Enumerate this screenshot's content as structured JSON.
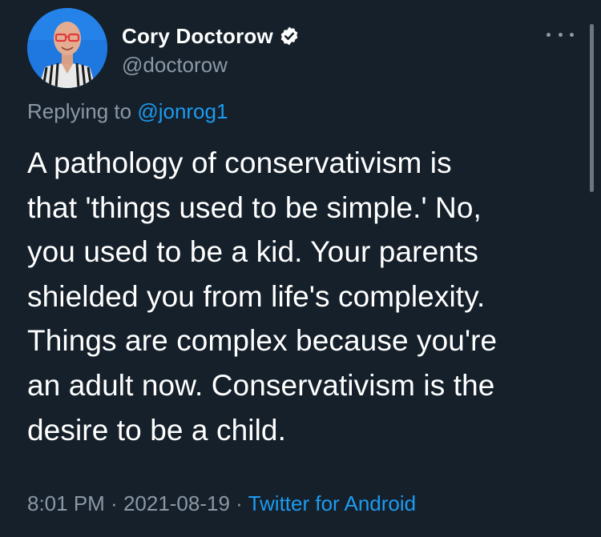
{
  "tweet": {
    "author": {
      "display_name": "Cory Doctorow",
      "handle": "@doctorow",
      "verified_icon": "verified-badge-icon"
    },
    "reply_prefix": "Replying to ",
    "reply_to": "@jonrog1",
    "text": "A pathology of conservativism is\nthat 'things used to be simple.' No,\nyou used to be a kid. Your parents\nshielded you from life's complexity.\nThings are complex because you're\nan adult now. Conservativism is the\ndesire to be a child.",
    "time": "8:01 PM",
    "separator": " · ",
    "date": "2021-08-19",
    "source": "Twitter for Android",
    "more_icon": "more-options-icon"
  },
  "colors": {
    "background": "#15202b",
    "text": "#ffffff",
    "secondary": "#8b98a5",
    "link": "#1d9bf0"
  }
}
